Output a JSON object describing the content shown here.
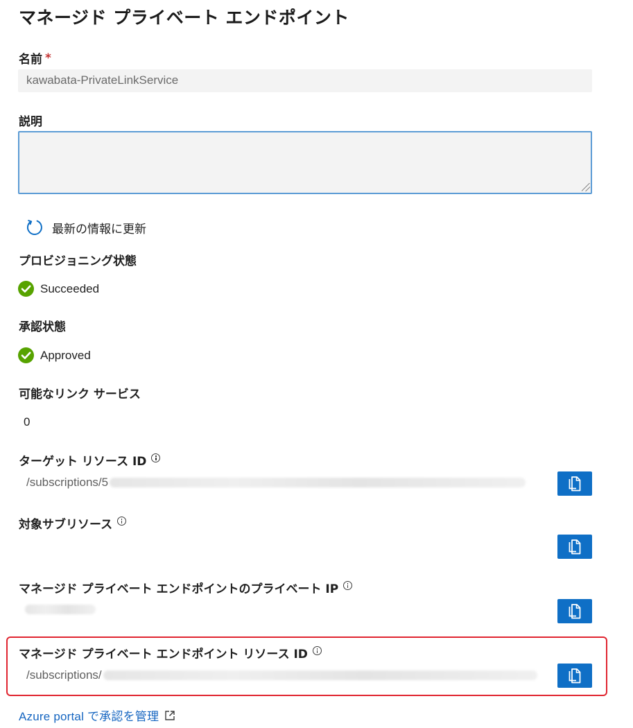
{
  "title": "マネージド プライベート エンドポイント",
  "name_field": {
    "label": "名前",
    "required_mark": "*",
    "value": "kawabata-PrivateLinkService"
  },
  "description_field": {
    "label": "説明",
    "value": ""
  },
  "refresh": {
    "label": "最新の情報に更新",
    "icon": "refresh-icon"
  },
  "provisioning": {
    "label": "プロビジョニング状態",
    "status": "Succeeded",
    "icon": "success-check-icon"
  },
  "approval": {
    "label": "承認状態",
    "status": "Approved",
    "icon": "success-check-icon"
  },
  "available_link_services": {
    "label": "可能なリンク サービス",
    "value": "0"
  },
  "target_resource_id": {
    "label": "ターゲット リソース ID",
    "value_prefix": "/subscriptions/5"
  },
  "target_subresource": {
    "label": "対象サブリソース",
    "value": ""
  },
  "private_ip": {
    "label": "マネージド プライベート エンドポイントのプライベート IP",
    "value": ""
  },
  "endpoint_resource_id": {
    "label": "マネージド プライベート エンドポイント リソース ID",
    "value_prefix": "/subscriptions/"
  },
  "portal_link": {
    "label": "Azure portal で承認を管理",
    "icon": "external-link-icon"
  },
  "colors": {
    "accent": "#0f6fc6",
    "success": "#57a300",
    "required": "#c43232",
    "highlight": "#e0242f",
    "link": "#1565c0"
  }
}
